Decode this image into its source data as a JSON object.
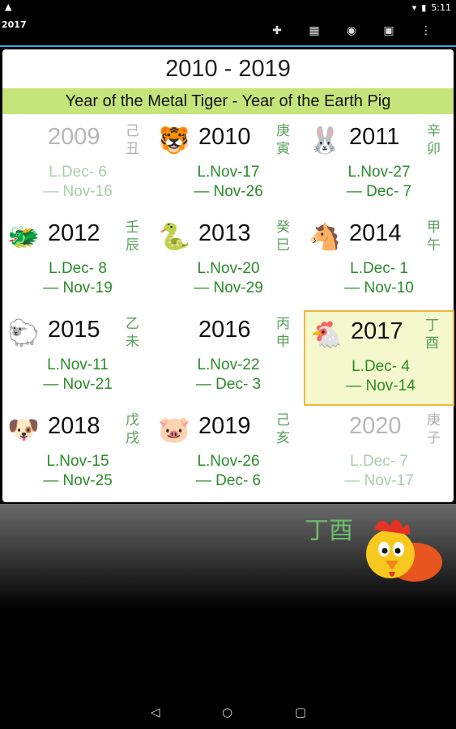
{
  "statusbar": {
    "warning": "▲",
    "time": "5:11"
  },
  "appbar": {
    "title": "2017"
  },
  "header": {
    "decade": "2010 - 2019",
    "subtitle": "Year of the Metal Tiger - Year of the Earth Pig"
  },
  "cells": [
    {
      "year": "2009",
      "cn1": "己",
      "cn2": "丑",
      "date1": "L.Dec- 6",
      "date2": "— Nov-16",
      "animal": "🐮",
      "dim": true
    },
    {
      "year": "2010",
      "cn1": "庚",
      "cn2": "寅",
      "date1": "L.Nov-17",
      "date2": "— Nov-26",
      "animal": "🐯",
      "dim": false
    },
    {
      "year": "2011",
      "cn1": "辛",
      "cn2": "卯",
      "date1": "L.Nov-27",
      "date2": "— Dec- 7",
      "animal": "🐰",
      "dim": false
    },
    {
      "year": "2012",
      "cn1": "壬",
      "cn2": "辰",
      "date1": "L.Dec- 8",
      "date2": "— Nov-19",
      "animal": "🐲",
      "dim": false
    },
    {
      "year": "2013",
      "cn1": "癸",
      "cn2": "巳",
      "date1": "L.Nov-20",
      "date2": "— Nov-29",
      "animal": "🐍",
      "dim": false
    },
    {
      "year": "2014",
      "cn1": "甲",
      "cn2": "午",
      "date1": "L.Dec- 1",
      "date2": "— Nov-10",
      "animal": "🐴",
      "dim": false
    },
    {
      "year": "2015",
      "cn1": "乙",
      "cn2": "未",
      "date1": "L.Nov-11",
      "date2": "— Nov-21",
      "animal": "🐑",
      "dim": false
    },
    {
      "year": "2016",
      "cn1": "丙",
      "cn2": "申",
      "date1": "L.Nov-22",
      "date2": "— Dec- 3",
      "animal": "🐵",
      "dim": false
    },
    {
      "year": "2017",
      "cn1": "丁",
      "cn2": "酉",
      "date1": "L.Dec- 4",
      "date2": "— Nov-14",
      "animal": "🐔",
      "dim": false,
      "highlight": true
    },
    {
      "year": "2018",
      "cn1": "戊",
      "cn2": "戌",
      "date1": "L.Nov-15",
      "date2": "— Nov-25",
      "animal": "🐶",
      "dim": false
    },
    {
      "year": "2019",
      "cn1": "己",
      "cn2": "亥",
      "date1": "L.Nov-26",
      "date2": "— Dec- 6",
      "animal": "🐷",
      "dim": false
    },
    {
      "year": "2020",
      "cn1": "庚",
      "cn2": "子",
      "date1": "L.Dec- 7",
      "date2": "— Nov-17",
      "animal": "🐭",
      "dim": true
    }
  ],
  "bottom": {
    "cn": "丁酉"
  },
  "colors": {
    "accent": "#35b3e6",
    "band": "#c5e57a",
    "highlight_border": "#f2b442",
    "text_green": "#2a8a2a"
  }
}
